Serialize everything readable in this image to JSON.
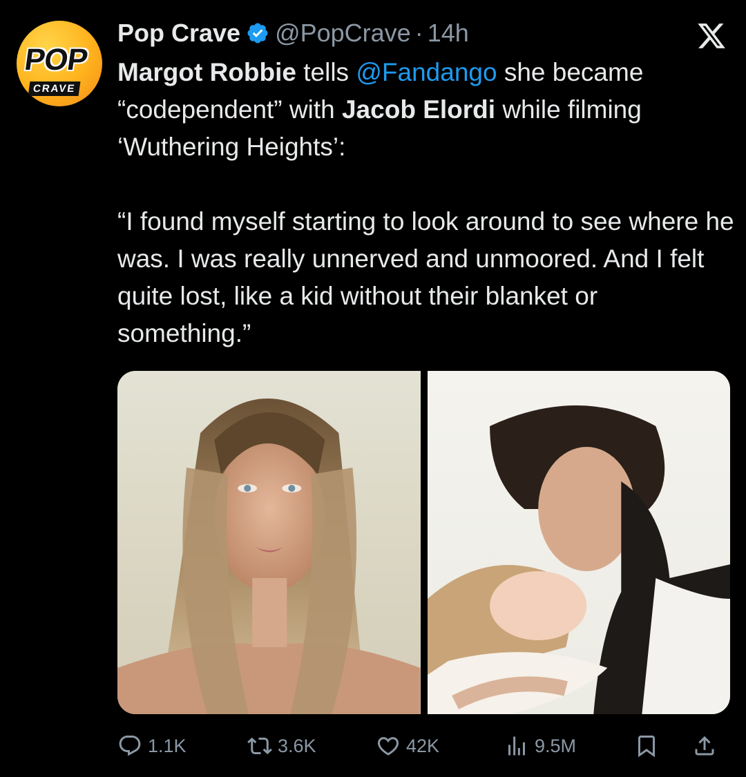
{
  "header": {
    "display_name": "Pop Crave",
    "handle": "@PopCrave",
    "separator": "·",
    "time": "14h"
  },
  "avatar": {
    "alt": "Pop Crave logo",
    "text_top": "POP",
    "text_bottom": "CRAVE"
  },
  "tweet": {
    "line1": {
      "bold1": "Margot Robbie",
      "t1": " tells ",
      "mention": "@Fandango",
      "t2": " she became “codependent” with ",
      "bold2": "Jacob Elordi",
      "t3": " while filming ‘Wuthering Heights’:"
    },
    "quote": "“I found myself starting to look around to see where he was. I was really unnerved and unmoored. And I felt quite lost, like a kid without their blanket or something.”"
  },
  "media": {
    "left_alt": "Portrait of Margot Robbie",
    "right_alt": "Jacob Elordi and Margot Robbie embracing"
  },
  "actions": {
    "replies": "1.1K",
    "reposts": "3.6K",
    "likes": "42K",
    "views": "9.5M"
  },
  "icons": {
    "verified": "verified-badge-icon",
    "x": "x-logo-icon",
    "reply": "reply-icon",
    "repost": "repost-icon",
    "like": "heart-icon",
    "views": "views-icon",
    "bookmark": "bookmark-icon",
    "share": "share-icon"
  },
  "colors": {
    "background": "#000000",
    "text": "#e7e9ea",
    "muted": "#8b98a5",
    "accent": "#1d9bf0"
  }
}
